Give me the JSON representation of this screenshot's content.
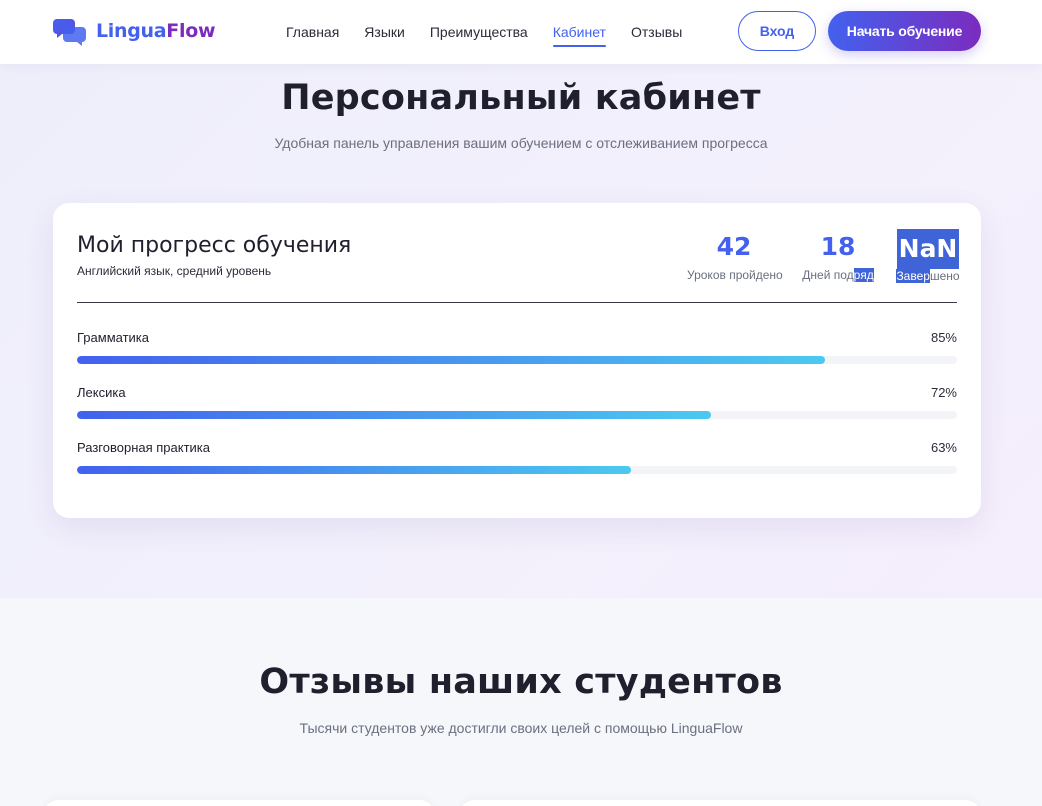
{
  "brand": {
    "name_part1": "Lingua",
    "name_part2": "Flow",
    "colors": {
      "primary": "#4361ee",
      "secondary": "#7b2cbf",
      "accent": "#4cc9f0"
    }
  },
  "nav": {
    "items": [
      {
        "label": "Главная"
      },
      {
        "label": "Языки"
      },
      {
        "label": "Преимущества"
      },
      {
        "label": "Кабинет",
        "active": true
      },
      {
        "label": "Отзывы"
      }
    ],
    "login_label": "Вход",
    "start_label": "Начать обучение"
  },
  "dashboard": {
    "title": "Персональный кабинет",
    "subtitle": "Удобная панель управления вашим обучением с отслеживанием прогресса",
    "card": {
      "title": "Мой прогресс обучения",
      "subtitle": "Английский язык, средний уровень",
      "stats": [
        {
          "value": "42",
          "label": "Уроков пройдено"
        },
        {
          "value": "18",
          "label_part1": "Дней под",
          "label_part2": "ряд"
        },
        {
          "value": "NaN",
          "label_part1": "Завер",
          "label_part2": "шено"
        }
      ],
      "skills": [
        {
          "name": "Грамматика",
          "percent_label": "85%",
          "percent": 85
        },
        {
          "name": "Лексика",
          "percent_label": "72%",
          "percent": 72
        },
        {
          "name": "Разговорная практика",
          "percent_label": "63%",
          "percent": 63
        }
      ]
    }
  },
  "reviews": {
    "title": "Отзывы наших студентов",
    "subtitle": "Тысячи студентов уже достигли своих целей с помощью LinguaFlow"
  }
}
